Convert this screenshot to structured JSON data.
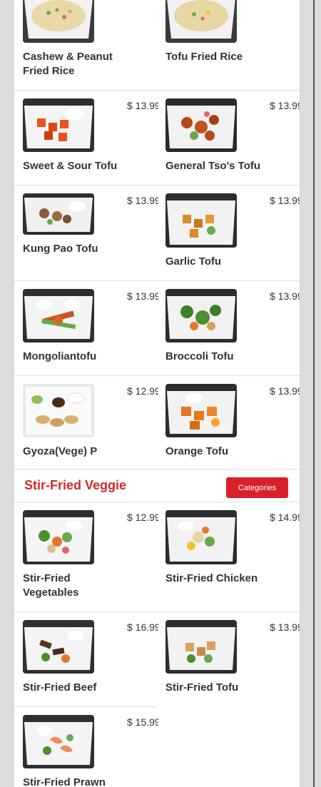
{
  "colors": {
    "accent": "#d9202a",
    "section_title": "#d12a2a",
    "text": "#333333",
    "background": "#dcdcdc"
  },
  "tofu_items": [
    {
      "name": "Cashew & Peanut Fried Rice",
      "price": ""
    },
    {
      "name": "Tofu Fried Rice",
      "price": ""
    },
    {
      "name": "Sweet & Sour Tofu",
      "price": "$ 13.99"
    },
    {
      "name": "General Tso's Tofu",
      "price": "$ 13.99"
    },
    {
      "name": "Kung Pao Tofu",
      "price": "$ 13.99"
    },
    {
      "name": "Garlic Tofu",
      "price": "$ 13.99"
    },
    {
      "name": "Mongoliantofu",
      "price": "$ 13.99"
    },
    {
      "name": "Broccoli Tofu",
      "price": "$ 13.99"
    },
    {
      "name": "Gyoza(Vege) Plate",
      "price": "$ 12.99"
    },
    {
      "name": "Orange Tofu",
      "price": "$ 13.99"
    }
  ],
  "section": {
    "title": "Stir-Fried Veggie",
    "categories_label": "Categories"
  },
  "veggie_items": [
    {
      "name": "Stir-Fried Vegetables",
      "price": "$ 12.99"
    },
    {
      "name": "Stir-Fried Chicken",
      "price": "$ 14.99"
    },
    {
      "name": "Stir-Fried Beef",
      "price": "$ 16.99"
    },
    {
      "name": "Stir-Fried Tofu",
      "price": "$ 13.99"
    },
    {
      "name": "Stir-Fried Prawn",
      "price": "$ 15.99"
    }
  ]
}
